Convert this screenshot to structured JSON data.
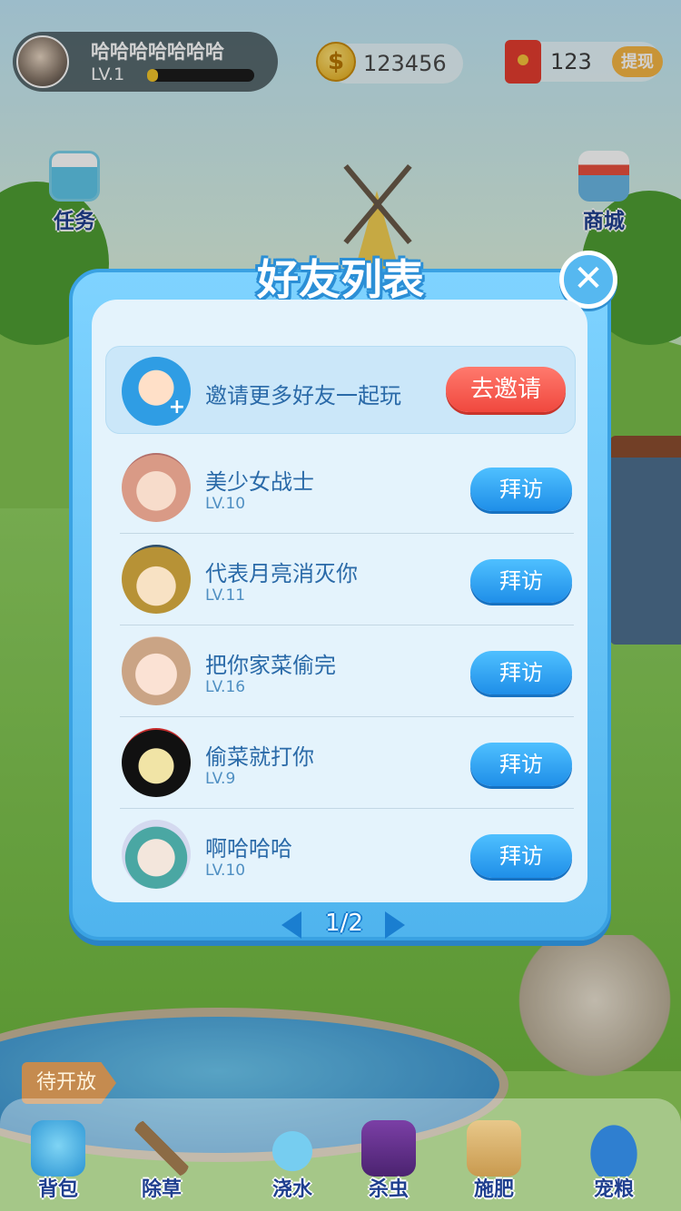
{
  "profile": {
    "nickname": "哈哈哈哈哈哈哈",
    "level": "LV.1",
    "xp_fraction": 0.1
  },
  "currency": {
    "coins": "123456",
    "coin_symbol": "$",
    "red_packets": "123",
    "withdraw_label": "提现"
  },
  "side_menu": {
    "task_label": "任务",
    "shop_label": "商城"
  },
  "friends_modal": {
    "title": "好友列表",
    "close_symbol": "✕",
    "invite": {
      "text": "邀请更多好友一起玩",
      "button_label": "去邀请",
      "plus": "+"
    },
    "friends": [
      {
        "name": "美少女战士",
        "level": "LV.10",
        "button_label": "拜访"
      },
      {
        "name": "代表月亮消灭你",
        "level": "LV.11",
        "button_label": "拜访"
      },
      {
        "name": "把你家菜偷完",
        "level": "LV.16",
        "button_label": "拜访"
      },
      {
        "name": "偷菜就打你",
        "level": "LV.9",
        "button_label": "拜访"
      },
      {
        "name": "啊哈哈哈",
        "level": "LV.10",
        "button_label": "拜访"
      }
    ],
    "pager": {
      "text": "1/2"
    }
  },
  "sign": {
    "coming_soon": "待开放"
  },
  "toolbar": {
    "items": [
      {
        "label": "背包",
        "icon": "backpack-icon"
      },
      {
        "label": "除草",
        "icon": "shovel-icon"
      },
      {
        "label": "浇水",
        "icon": "watering-can-icon"
      },
      {
        "label": "杀虫",
        "icon": "pesticide-icon"
      },
      {
        "label": "施肥",
        "icon": "fertilizer-icon"
      },
      {
        "label": "宠粮",
        "icon": "pet-food-icon"
      }
    ]
  },
  "colors": {
    "modal_blue": "#4fb4ee",
    "invite_red": "#f0483e",
    "visit_blue": "#1f8ee8",
    "label_navy": "#1f3f8f"
  }
}
